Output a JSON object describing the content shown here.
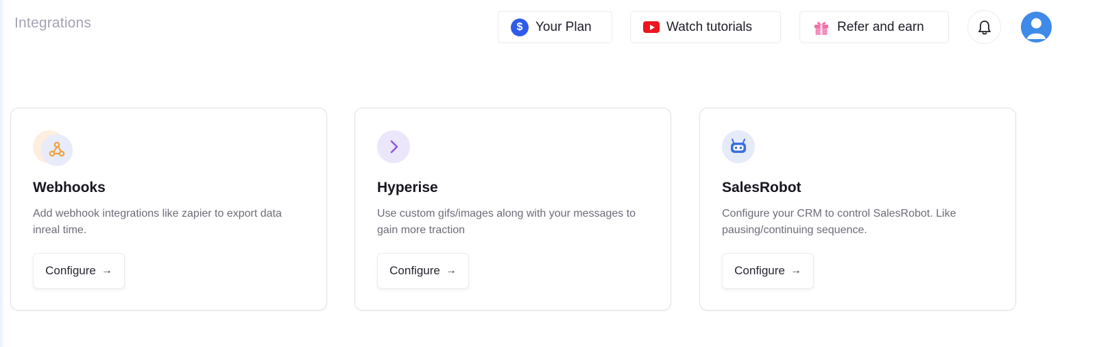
{
  "header": {
    "title": "Integrations",
    "buttons": [
      {
        "label": "Your Plan",
        "icon": "dollar-icon"
      },
      {
        "label": "Watch tutorials",
        "icon": "youtube-icon"
      },
      {
        "label": "Refer and earn",
        "icon": "gift-icon"
      }
    ],
    "notifications_icon": "bell-icon",
    "avatar_icon": "user-avatar-icon"
  },
  "integrations": [
    {
      "name": "Webhooks",
      "description": "Add webhook integrations like zapier to export data inreal time.",
      "action_label": "Configure",
      "arrow": "→",
      "icon": "webhook-icon"
    },
    {
      "name": "Hyperise",
      "description": "Use custom gifs/images along with your messages to gain more traction",
      "action_label": "Configure",
      "arrow": "→",
      "icon": "chevron-right-icon"
    },
    {
      "name": "SalesRobot",
      "description": "Configure your CRM to control SalesRobot. Like pausing/continuing sequence.",
      "action_label": "Configure",
      "arrow": "→",
      "icon": "robot-icon"
    }
  ],
  "colors": {
    "accent_blue": "#2f5bea",
    "youtube_red": "#f0141e",
    "gift_pink": "#f06fa8",
    "avatar_blue": "#3f8ae8",
    "muted_title": "#a3a3b3"
  }
}
